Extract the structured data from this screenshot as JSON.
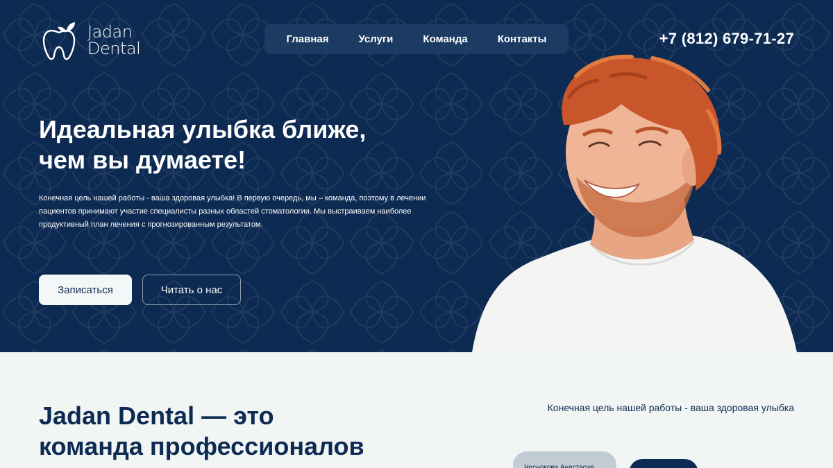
{
  "brand": {
    "line1": "Jadan",
    "line2": "Dental"
  },
  "nav": {
    "items": [
      "Главная",
      "Услуги",
      "Команда",
      "Контакты"
    ]
  },
  "phone": "+7 (812) 679-71-27",
  "hero": {
    "title_line1": "Идеальная улыбка ближе,",
    "title_line2": "чем вы думаете!",
    "description": "Конечная цель нашей работы - ваша здоровая улыбка!  В первую очередь, мы – команда, поэтому в лечении пациентов принимают участие специалисты разных областей стоматологии. Мы выстраиваем наиболее продуктивный план лечения с прогнозированным результатом.",
    "primary_button": "Записаться",
    "secondary_button": "Читать о нас"
  },
  "about": {
    "title_line1": "Jadan Dental — это",
    "title_line2": "команда профессионалов",
    "tagline": "Конечная цель нашей работы - ваша здоровая улыбка",
    "doctor_chip": "Чеснокова Анастасия"
  },
  "colors": {
    "navy": "#0d2a52",
    "light_bg": "#f1f5f4",
    "nav_bg": "#1e3e66",
    "hair": "#c9562a"
  }
}
